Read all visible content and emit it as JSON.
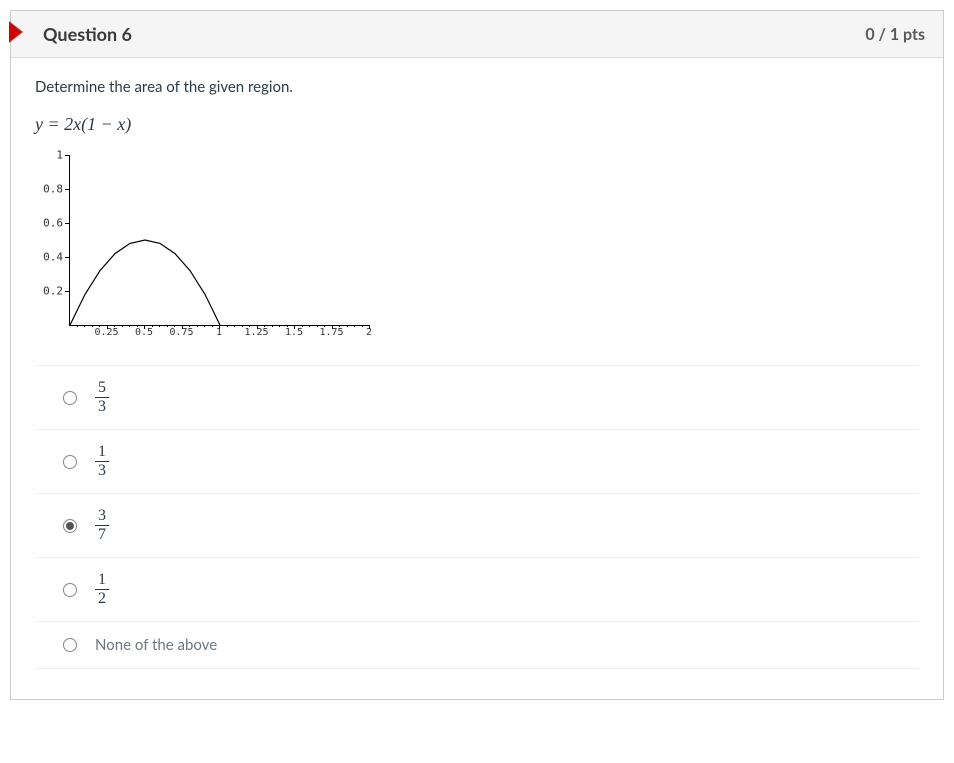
{
  "header": {
    "title": "Question 6",
    "points": "0 / 1 pts"
  },
  "body": {
    "prompt": "Determine the area of the given region.",
    "equation": "y = 2x(1 − x)"
  },
  "chart_data": {
    "type": "line",
    "title": "",
    "xlabel": "",
    "ylabel": "",
    "xlim": [
      0,
      2
    ],
    "ylim": [
      0,
      1
    ],
    "x_ticks": [
      0.25,
      0.5,
      0.75,
      1,
      1.25,
      1.5,
      1.75,
      2
    ],
    "y_ticks": [
      0.2,
      0.4,
      0.6,
      0.8,
      1
    ],
    "series": [
      {
        "name": "y=2x(1-x)",
        "x": [
          0,
          0.1,
          0.2,
          0.3,
          0.4,
          0.5,
          0.6,
          0.7,
          0.8,
          0.9,
          1.0
        ],
        "values": [
          0,
          0.18,
          0.32,
          0.42,
          0.48,
          0.5,
          0.48,
          0.42,
          0.32,
          0.18,
          0
        ]
      }
    ]
  },
  "options": [
    {
      "type": "fraction",
      "num": "5",
      "den": "3",
      "checked": false
    },
    {
      "type": "fraction",
      "num": "1",
      "den": "3",
      "checked": false
    },
    {
      "type": "fraction",
      "num": "3",
      "den": "7",
      "checked": true
    },
    {
      "type": "fraction",
      "num": "1",
      "den": "2",
      "checked": false
    },
    {
      "type": "text",
      "label": "None of the above",
      "checked": false
    }
  ]
}
